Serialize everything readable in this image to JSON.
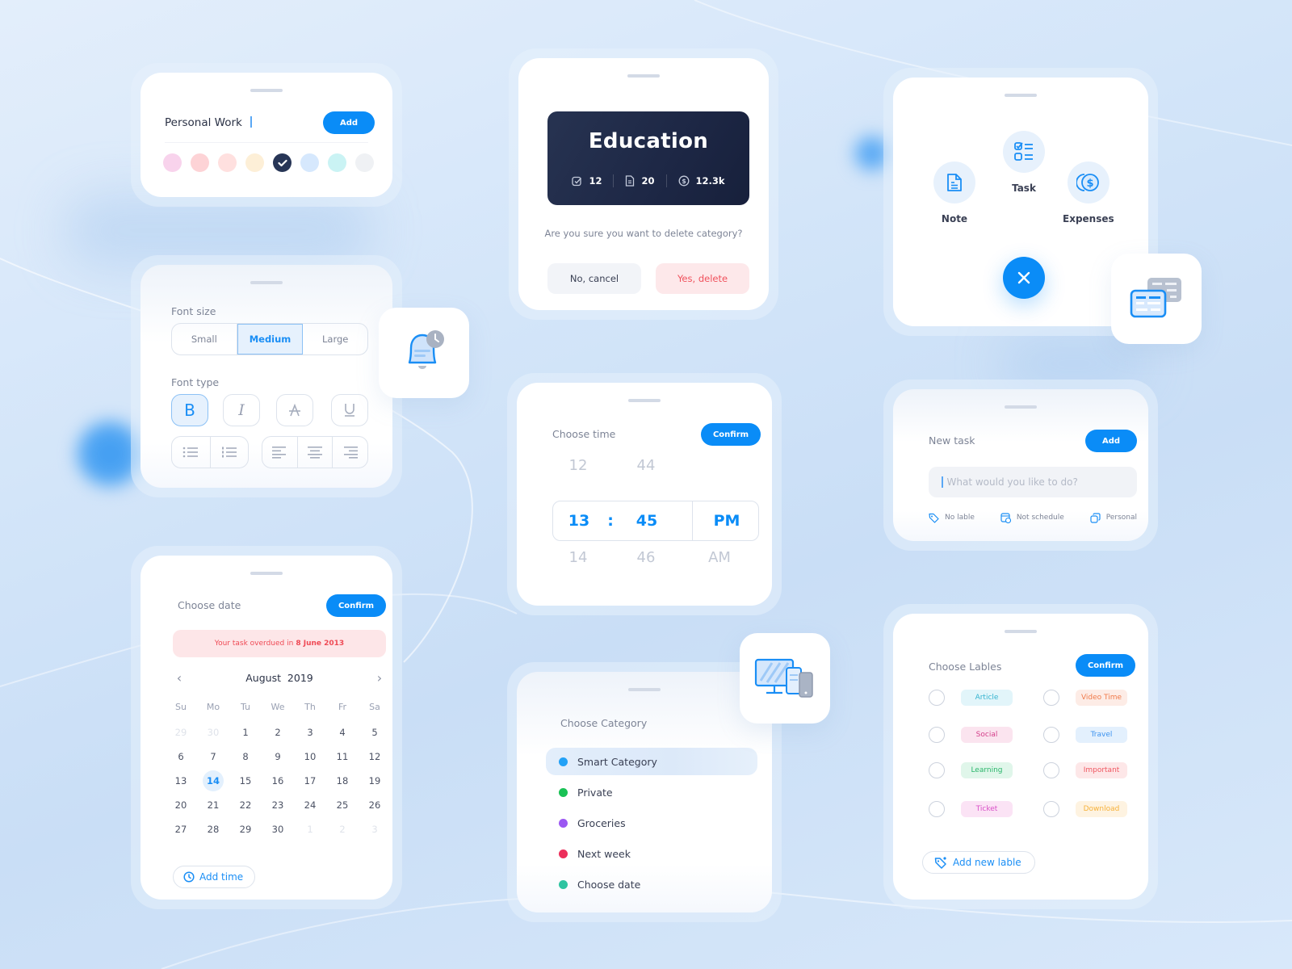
{
  "colors": {
    "accent": "#0a8cf7",
    "danger": "#f0515c",
    "dark_navy": "#1d2745"
  },
  "personal_work": {
    "title": "Personal Work",
    "add_label": "Add",
    "swatches": [
      {
        "color": "#f8d3ec",
        "selected": false
      },
      {
        "color": "#fdd3d6",
        "selected": false
      },
      {
        "color": "#ffe0df",
        "selected": false
      },
      {
        "color": "#fdefd7",
        "selected": false
      },
      {
        "color": "#273556",
        "selected": true
      },
      {
        "color": "#d6e8fd",
        "selected": false
      },
      {
        "color": "#caf3f4",
        "selected": false
      },
      {
        "color": "#eff1f4",
        "selected": false
      }
    ]
  },
  "font_settings": {
    "font_size_label": "Font size",
    "sizes": [
      "Small",
      "Medium",
      "Large"
    ],
    "selected_size": "Medium",
    "font_type_label": "Font type",
    "styles": [
      {
        "name": "bold",
        "glyph": "B",
        "active": true
      },
      {
        "name": "italic",
        "glyph": "I",
        "active": false
      },
      {
        "name": "strikethrough",
        "glyph": "A",
        "active": false
      },
      {
        "name": "underline",
        "glyph": "U",
        "active": false
      }
    ],
    "lists": [
      "bullet-list",
      "numbered-list"
    ],
    "alignments": [
      "align-left",
      "align-center",
      "align-right"
    ]
  },
  "date_picker": {
    "title": "Choose date",
    "confirm_label": "Confirm",
    "overdue_text": "Your task overdued in",
    "overdue_date": "8 June 2013",
    "month": "August  2019",
    "weekdays": [
      "Su",
      "Mo",
      "Tu",
      "We",
      "Th",
      "Fr",
      "Sa"
    ],
    "weeks": [
      [
        {
          "d": "29",
          "m": true
        },
        {
          "d": "30",
          "m": true
        },
        {
          "d": "1"
        },
        {
          "d": "2"
        },
        {
          "d": "3"
        },
        {
          "d": "4"
        },
        {
          "d": "5"
        }
      ],
      [
        {
          "d": "6"
        },
        {
          "d": "7"
        },
        {
          "d": "8"
        },
        {
          "d": "9"
        },
        {
          "d": "10"
        },
        {
          "d": "11"
        },
        {
          "d": "12"
        }
      ],
      [
        {
          "d": "13"
        },
        {
          "d": "14",
          "sel": true
        },
        {
          "d": "15"
        },
        {
          "d": "16"
        },
        {
          "d": "17"
        },
        {
          "d": "18"
        },
        {
          "d": "19"
        }
      ],
      [
        {
          "d": "20"
        },
        {
          "d": "21"
        },
        {
          "d": "22"
        },
        {
          "d": "23"
        },
        {
          "d": "24"
        },
        {
          "d": "25"
        },
        {
          "d": "26"
        }
      ],
      [
        {
          "d": "27"
        },
        {
          "d": "28"
        },
        {
          "d": "29"
        },
        {
          "d": "30"
        },
        {
          "d": "1",
          "m": true
        },
        {
          "d": "2",
          "m": true
        },
        {
          "d": "3",
          "m": true
        }
      ]
    ],
    "selected_day": "14",
    "add_time_label": "Add time"
  },
  "delete_category": {
    "category_name": "Education",
    "tasks_count": "12",
    "notes_count": "20",
    "expenses_total": "12.3k",
    "question": "Are you sure you want to delete category?",
    "cancel_label": "No, cancel",
    "delete_label": "Yes, delete"
  },
  "time_picker": {
    "title": "Choose time",
    "confirm_label": "Confirm",
    "hour_prev": "12",
    "minute_prev": "44",
    "hour": "13",
    "separator": ":",
    "minute": "45",
    "period": "PM",
    "hour_next": "14",
    "minute_next": "46",
    "period_next": "AM"
  },
  "category_picker": {
    "title": "Choose Category",
    "items": [
      {
        "label": "Smart Category",
        "color": "#23a1f6",
        "active": true
      },
      {
        "label": "Private",
        "color": "#19c155",
        "active": false
      },
      {
        "label": "Groceries",
        "color": "#9b57f2",
        "active": false
      },
      {
        "label": "Next week",
        "color": "#ec2f5b",
        "active": false
      },
      {
        "label": "Choose date",
        "color": "#2ec4a1",
        "active": false
      }
    ]
  },
  "quick_actions": {
    "note_label": "Note",
    "task_label": "Task",
    "expenses_label": "Expenses"
  },
  "new_task": {
    "title": "New task",
    "add_label": "Add",
    "placeholder": "What would you like to do?",
    "label_option": "No lable",
    "schedule_option": "Not schedule",
    "category_option": "Personal"
  },
  "label_picker": {
    "title": "Choose Lables",
    "confirm_label": "Confirm",
    "labels": [
      {
        "name": "Article",
        "bg": "#e2f5fa",
        "fg": "#36b4d0"
      },
      {
        "name": "Video Time",
        "bg": "#fdece6",
        "fg": "#f07a4a"
      },
      {
        "name": "Social",
        "bg": "#fbe4ef",
        "fg": "#d43f8a"
      },
      {
        "name": "Travel",
        "bg": "#e3f0fd",
        "fg": "#3d93ef"
      },
      {
        "name": "Learning",
        "bg": "#e0f6ea",
        "fg": "#29b56a"
      },
      {
        "name": "Important",
        "bg": "#fde7e8",
        "fg": "#f05761"
      },
      {
        "name": "Ticket",
        "bg": "#fbe3f5",
        "fg": "#d84fc7"
      },
      {
        "name": "Download",
        "bg": "#fef3e1",
        "fg": "#f6b13a"
      }
    ],
    "add_label": "Add new lable"
  }
}
